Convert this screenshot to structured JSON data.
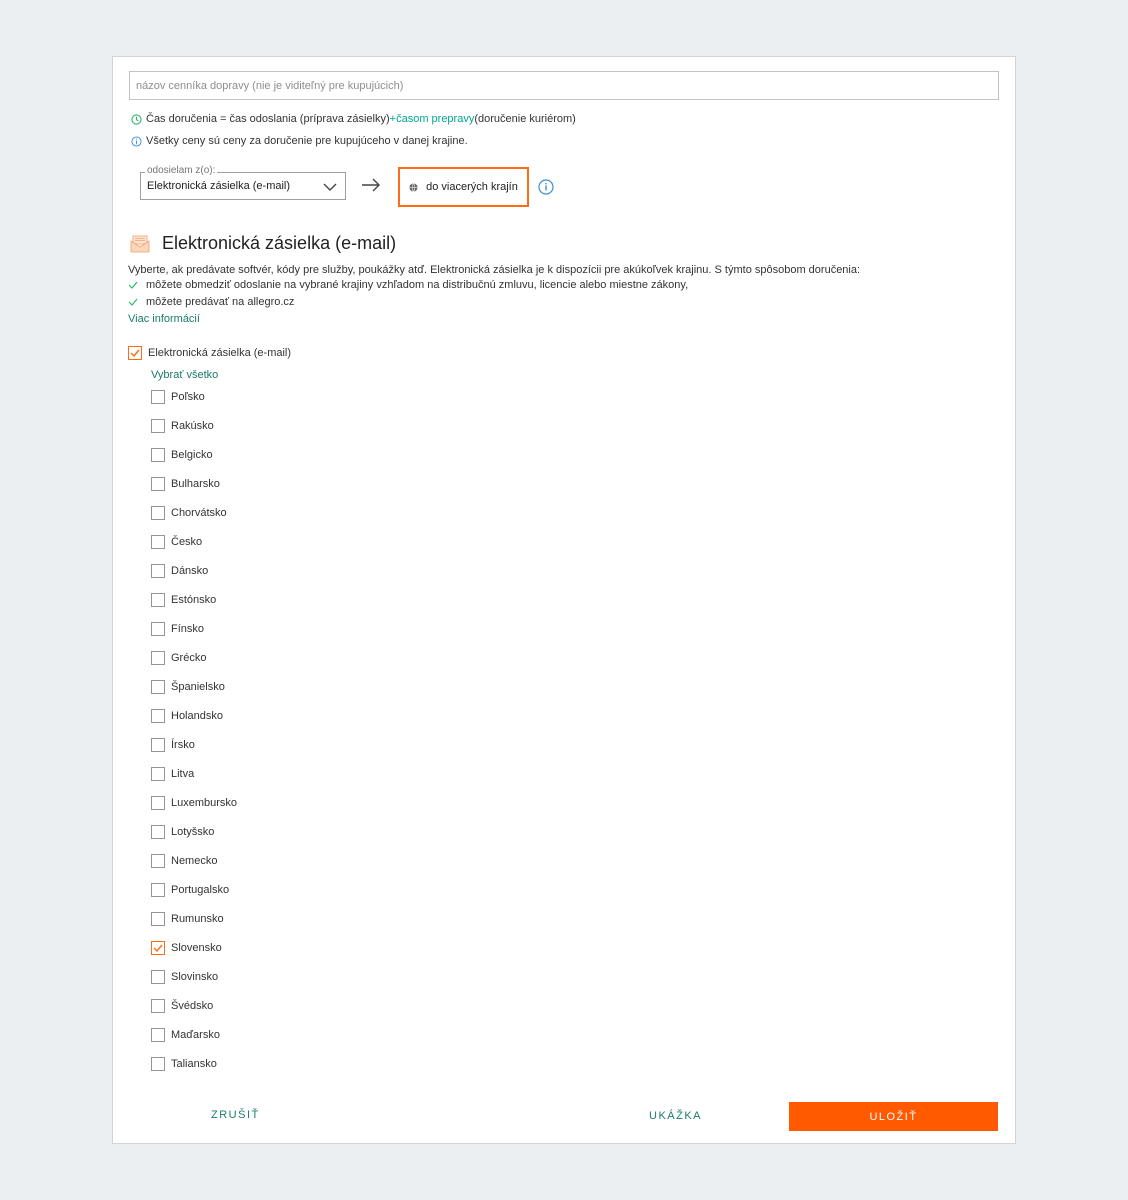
{
  "form": {
    "name_placeholder": "názov cenníka dopravy (nie je viditeľný pre kupujúcich)",
    "name_value": ""
  },
  "info": {
    "delivery_time_prefix": "Čas doručenia = čas odoslania (príprava zásielky) ",
    "delivery_time_link": "+časom prepravy",
    "delivery_time_suffix": " (doručenie kuriérom)",
    "prices_note": "Všetky ceny sú ceny za doručenie pre kupujúceho v danej krajine."
  },
  "shipping": {
    "origin_label": "odosielam z(o):",
    "origin_value": "Elektronická zásielka (e-mail)",
    "destination_label": "do viacerých krajín"
  },
  "section": {
    "title": "Elektronická zásielka (e-mail)",
    "description": "Vyberte, ak predávate softvér, kódy pre služby, poukážky atď. Elektronická zásielka je k dispozícii pre akúkoľvek krajinu. S týmto spôsobom doručenia:",
    "bullets": [
      "môžete obmedziť odoslanie na vybrané krajiny vzhľadom na distribučnú zmluvu, licencie alebo miestne zákony,",
      "môžete predávať na allegro.cz"
    ],
    "more_info": "Viac informácií"
  },
  "method": {
    "label": "Elektronická zásielka (e-mail)",
    "checked": true,
    "select_all": "Vybrať všetko"
  },
  "countries": [
    {
      "name": "Poľsko",
      "checked": false
    },
    {
      "name": "Rakúsko",
      "checked": false
    },
    {
      "name": "Belgicko",
      "checked": false
    },
    {
      "name": "Bulharsko",
      "checked": false
    },
    {
      "name": "Chorvátsko",
      "checked": false
    },
    {
      "name": "Česko",
      "checked": false
    },
    {
      "name": "Dánsko",
      "checked": false
    },
    {
      "name": "Estónsko",
      "checked": false
    },
    {
      "name": "Fínsko",
      "checked": false
    },
    {
      "name": "Grécko",
      "checked": false
    },
    {
      "name": "Španielsko",
      "checked": false
    },
    {
      "name": "Holandsko",
      "checked": false
    },
    {
      "name": "Írsko",
      "checked": false
    },
    {
      "name": "Litva",
      "checked": false
    },
    {
      "name": "Luxembursko",
      "checked": false
    },
    {
      "name": "Lotyšsko",
      "checked": false
    },
    {
      "name": "Nemecko",
      "checked": false
    },
    {
      "name": "Portugalsko",
      "checked": false
    },
    {
      "name": "Rumunsko",
      "checked": false
    },
    {
      "name": "Slovensko",
      "checked": true
    },
    {
      "name": "Slovinsko",
      "checked": false
    },
    {
      "name": "Švédsko",
      "checked": false
    },
    {
      "name": "Maďarsko",
      "checked": false
    },
    {
      "name": "Taliansko",
      "checked": false
    }
  ],
  "footer": {
    "cancel": "ZRUŠIŤ",
    "preview": "UKÁŽKA",
    "save": "ULOŽIŤ"
  },
  "colors": {
    "accent": "#ff5a00",
    "link": "#00a790",
    "teal": "#1a7b6a",
    "check_green": "#2eb872"
  }
}
